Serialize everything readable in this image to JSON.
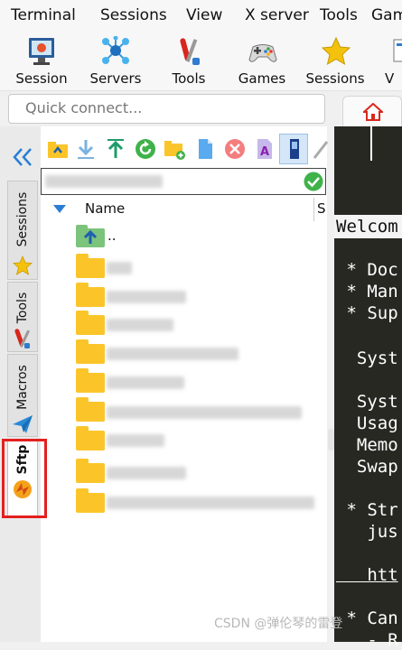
{
  "menubar": {
    "items": [
      "Terminal",
      "Sessions",
      "View",
      "X server",
      "Tools",
      "Gam"
    ]
  },
  "toolbar": {
    "buttons": [
      {
        "label": "Session",
        "icon": "monitor-icon"
      },
      {
        "label": "Servers",
        "icon": "network-icon"
      },
      {
        "label": "Tools",
        "icon": "tools-icon"
      },
      {
        "label": "Games",
        "icon": "gamepad-icon"
      },
      {
        "label": "Sessions",
        "icon": "star-icon"
      },
      {
        "label": "V",
        "icon": "view-icon"
      }
    ]
  },
  "quick_connect": {
    "placeholder": "Quick connect..."
  },
  "sidebar": {
    "collapse_icon": "double-chevron-left-icon",
    "tabs": [
      {
        "label": "Sessions",
        "icon": "star-icon"
      },
      {
        "label": "Tools",
        "icon": "tools-icon"
      },
      {
        "label": "Macros",
        "icon": "paper-plane-icon"
      },
      {
        "label": "Sftp",
        "icon": "sftp-icon",
        "active": true
      }
    ]
  },
  "sftp": {
    "toolbar_icons": [
      "folder-up-icon",
      "download-icon",
      "upload-icon",
      "refresh-icon",
      "new-folder-icon",
      "new-file-icon",
      "delete-icon",
      "rename-icon",
      "follow-terminal-icon",
      "edit-icon"
    ],
    "columns": [
      "Name",
      "S"
    ],
    "parent_entry": "..",
    "files": [
      "",
      "",
      "",
      "",
      "",
      "",
      "",
      "",
      "",
      ""
    ]
  },
  "terminal": {
    "lines": [
      "Welcom",
      " * Doc",
      " * Man",
      " * Sup",
      "  Syst",
      "  Syst",
      "  Usag",
      "  Memo",
      "  Swap",
      " * Str",
      "   jus",
      "   htt",
      " * Can",
      "   - R"
    ]
  },
  "watermark": "CSDN @弹伦琴的雷登",
  "colors": {
    "highlight": "#e3201e",
    "folder": "#fbc52a",
    "terminal_bg": "#272822",
    "accent_blue": "#2a7fd4"
  }
}
